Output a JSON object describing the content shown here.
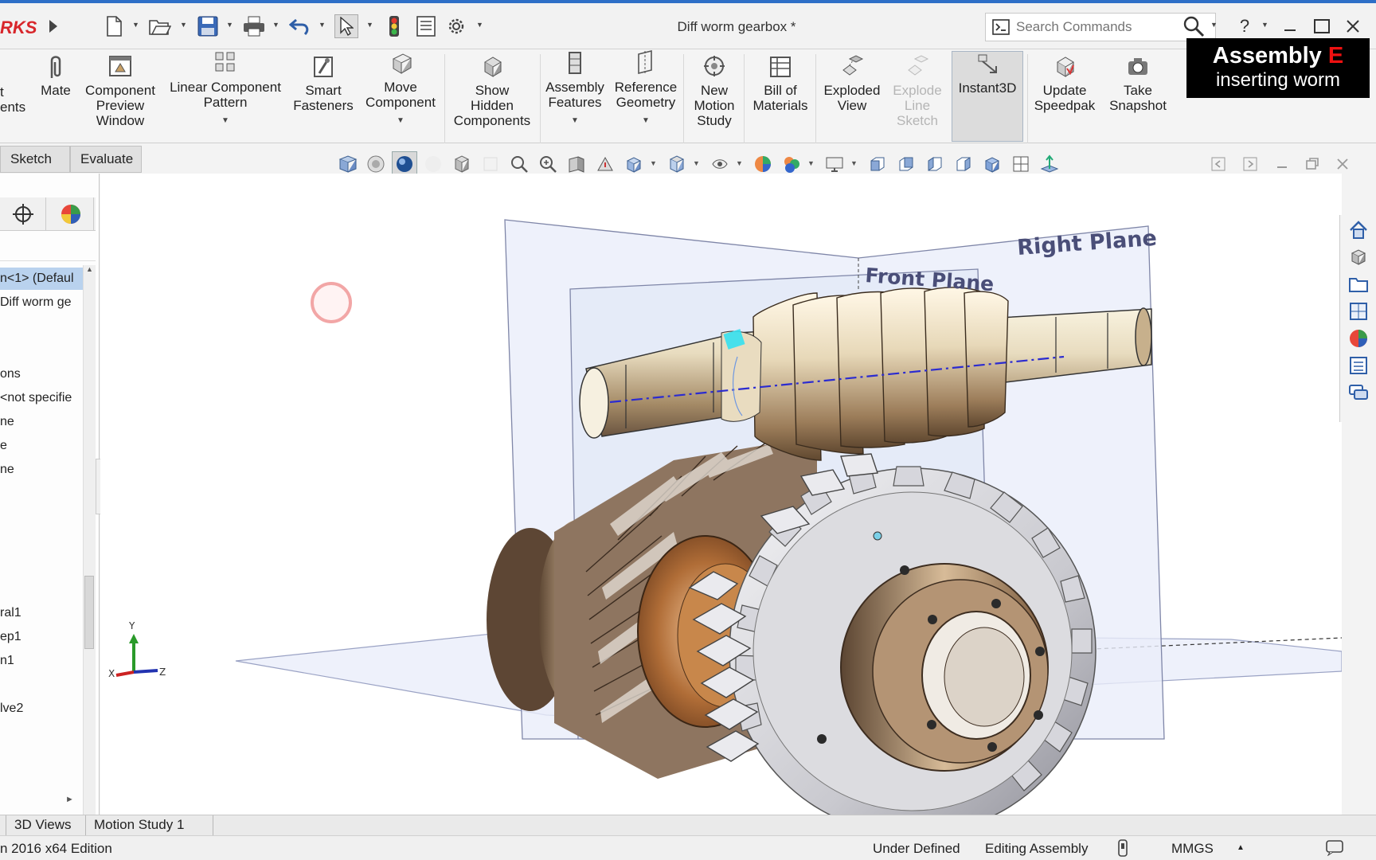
{
  "brand": {
    "text": "RKS"
  },
  "title_bar": {
    "document_title": "Diff worm gearbox *",
    "search_placeholder": "Search Commands",
    "help": "?"
  },
  "overlay": {
    "title": "Assembly",
    "title_letter": "E",
    "subtitle": "inserting worm"
  },
  "ribbon": {
    "items": [
      {
        "label": "t\nents"
      },
      {
        "label": "Mate"
      },
      {
        "label": "Component\nPreview\nWindow"
      },
      {
        "label": "Linear Component\nPattern"
      },
      {
        "label": "Smart\nFasteners"
      },
      {
        "label": "Move\nComponent"
      },
      {
        "label": "Show\nHidden\nComponents"
      },
      {
        "label": "Assembly\nFeatures"
      },
      {
        "label": "Reference\nGeometry"
      },
      {
        "label": "New\nMotion\nStudy"
      },
      {
        "label": "Bill of\nMaterials"
      },
      {
        "label": "Exploded\nView"
      },
      {
        "label": "Explode\nLine\nSketch"
      },
      {
        "label": "Instant3D"
      },
      {
        "label": "Update\nSpeedpak"
      },
      {
        "label": "Take\nSnapshot"
      }
    ]
  },
  "cm_tabs": [
    "Sketch",
    "Evaluate"
  ],
  "feature_tree": [
    {
      "text": "n<1> (Defaul",
      "selected": true
    },
    {
      "text": "Diff worm ge"
    },
    {
      "text": "ons"
    },
    {
      "text": "<not specifie"
    },
    {
      "text": "ne"
    },
    {
      "text": "e"
    },
    {
      "text": "ne"
    },
    {
      "text": "ral1"
    },
    {
      "text": "ep1"
    },
    {
      "text": "n1"
    },
    {
      "text": "lve2"
    }
  ],
  "viewport": {
    "right_plane_label": "Right Plane",
    "front_plane_label": "Front Plane",
    "triad": {
      "x": "X",
      "y": "Y",
      "z": "Z"
    }
  },
  "bottom_tabs": [
    "3D Views",
    "Motion Study 1"
  ],
  "status_bar": {
    "edition": "n 2016 x64 Edition",
    "definition": "Under Defined",
    "mode": "Editing Assembly",
    "units": "MMGS"
  }
}
